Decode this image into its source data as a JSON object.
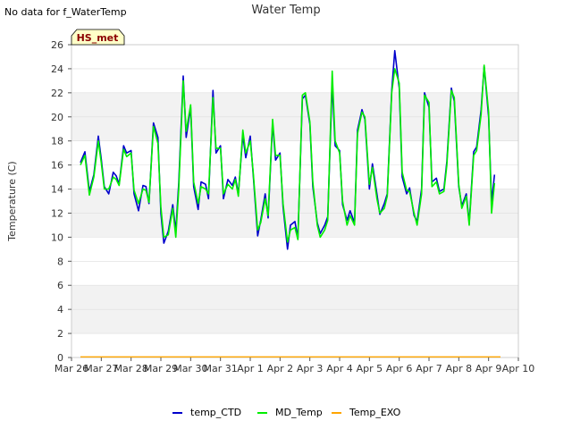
{
  "notice": "No data for f_WaterTemp",
  "badge": "HS_met",
  "chart_data": {
    "type": "line",
    "title": "Water Temp",
    "ylabel": "Temperature (C)",
    "xlabel": "",
    "ylim": [
      0,
      26
    ],
    "yticks": [
      0,
      2,
      4,
      6,
      8,
      10,
      12,
      14,
      16,
      18,
      20,
      22,
      24,
      26
    ],
    "xlim": [
      "Mar 26",
      "Apr 10"
    ],
    "xticks": [
      "Mar 26",
      "Mar 27",
      "Mar 28",
      "Mar 29",
      "Mar 30",
      "Mar 31",
      "Apr 1",
      "Apr 2",
      "Apr 3",
      "Apr 4",
      "Apr 5",
      "Apr 6",
      "Apr 7",
      "Apr 8",
      "Apr 9",
      "Apr 10"
    ],
    "grid": "horizontal bands",
    "legend_position": "bottom",
    "series": [
      {
        "name": "temp_CTD",
        "color": "#0000cc",
        "x": [
          0.3,
          0.45,
          0.6,
          0.75,
          0.9,
          1.0,
          1.1,
          1.25,
          1.4,
          1.5,
          1.6,
          1.75,
          1.85,
          2.0,
          2.1,
          2.25,
          2.4,
          2.5,
          2.6,
          2.75,
          2.9,
          3.0,
          3.1,
          3.25,
          3.4,
          3.5,
          3.6,
          3.75,
          3.85,
          4.0,
          4.1,
          4.25,
          4.35,
          4.5,
          4.6,
          4.75,
          4.85,
          5.0,
          5.1,
          5.25,
          5.4,
          5.5,
          5.6,
          5.75,
          5.85,
          6.0,
          6.1,
          6.25,
          6.35,
          6.5,
          6.6,
          6.75,
          6.85,
          7.0,
          7.1,
          7.25,
          7.35,
          7.5,
          7.6,
          7.75,
          7.85,
          8.0,
          8.1,
          8.25,
          8.35,
          8.5,
          8.6,
          8.75,
          8.85,
          9.0,
          9.1,
          9.25,
          9.35,
          9.5,
          9.6,
          9.75,
          9.85,
          10.0,
          10.1,
          10.25,
          10.35,
          10.5,
          10.6,
          10.75,
          10.85,
          11.0,
          11.1,
          11.25,
          11.35,
          11.5,
          11.6,
          11.75,
          11.85,
          12.0,
          12.1,
          12.25,
          12.35,
          12.5,
          12.6,
          12.75,
          12.85,
          13.0,
          13.1,
          13.25,
          13.35,
          13.5,
          13.6,
          13.75,
          13.85,
          14.0,
          14.1,
          14.2
        ],
        "y": [
          16.2,
          17.1,
          13.8,
          15.2,
          18.4,
          16.5,
          14.2,
          13.6,
          15.4,
          15.1,
          14.4,
          17.6,
          17.0,
          17.2,
          13.6,
          12.2,
          14.3,
          14.2,
          12.8,
          19.5,
          18.3,
          12.0,
          9.5,
          10.5,
          12.7,
          10.5,
          14.5,
          23.4,
          18.3,
          20.8,
          14.2,
          12.3,
          14.6,
          14.4,
          13.2,
          22.2,
          17.0,
          17.6,
          13.2,
          14.8,
          14.3,
          15.0,
          13.6,
          18.5,
          16.6,
          18.4,
          15.2,
          10.1,
          11.4,
          13.6,
          11.6,
          19.5,
          16.4,
          17.0,
          12.5,
          9.0,
          11.0,
          11.3,
          9.9,
          21.5,
          21.8,
          19.4,
          14.2,
          11.2,
          10.3,
          11.0,
          11.7,
          22.8,
          17.6,
          17.2,
          12.7,
          11.4,
          12.2,
          11.2,
          18.9,
          20.6,
          19.8,
          14.0,
          16.1,
          13.6,
          11.9,
          12.8,
          13.6,
          22.2,
          25.5,
          22.4,
          15.0,
          13.6,
          14.1,
          11.8,
          11.3,
          14.0,
          22.0,
          20.8,
          14.6,
          14.9,
          13.8,
          14.0,
          16.3,
          22.4,
          21.3,
          14.2,
          12.6,
          13.6,
          11.2,
          17.1,
          17.5,
          20.6,
          24.2,
          20.0,
          12.9,
          15.2
        ]
      },
      {
        "name": "MD_Temp",
        "color": "#00ee00",
        "x": [
          0.3,
          0.45,
          0.6,
          0.75,
          0.9,
          1.0,
          1.1,
          1.25,
          1.4,
          1.5,
          1.6,
          1.75,
          1.85,
          2.0,
          2.1,
          2.25,
          2.4,
          2.5,
          2.6,
          2.75,
          2.9,
          3.0,
          3.1,
          3.25,
          3.4,
          3.5,
          3.6,
          3.75,
          3.85,
          4.0,
          4.1,
          4.25,
          4.35,
          4.5,
          4.6,
          4.75,
          4.85,
          5.0,
          5.1,
          5.25,
          5.4,
          5.5,
          5.6,
          5.75,
          5.85,
          6.0,
          6.1,
          6.25,
          6.35,
          6.5,
          6.6,
          6.75,
          6.85,
          7.0,
          7.1,
          7.25,
          7.35,
          7.5,
          7.6,
          7.75,
          7.85,
          8.0,
          8.1,
          8.25,
          8.35,
          8.5,
          8.6,
          8.75,
          8.85,
          9.0,
          9.1,
          9.25,
          9.35,
          9.5,
          9.6,
          9.75,
          9.85,
          10.0,
          10.1,
          10.25,
          10.35,
          10.5,
          10.6,
          10.75,
          10.85,
          11.0,
          11.1,
          11.25,
          11.35,
          11.5,
          11.6,
          11.75,
          11.85,
          12.0,
          12.1,
          12.25,
          12.35,
          12.5,
          12.6,
          12.75,
          12.85,
          13.0,
          13.1,
          13.25,
          13.35,
          13.5,
          13.6,
          13.75,
          13.85,
          14.0,
          14.1,
          14.2
        ],
        "y": [
          16.0,
          16.8,
          13.5,
          15.0,
          18.0,
          16.2,
          14.0,
          14.0,
          15.0,
          14.8,
          14.3,
          17.3,
          16.7,
          17.0,
          13.9,
          12.8,
          14.0,
          13.9,
          12.9,
          19.2,
          17.8,
          12.5,
          10.0,
          10.2,
          12.4,
          10.0,
          14.0,
          23.0,
          18.8,
          21.0,
          14.6,
          12.8,
          14.2,
          14.0,
          13.6,
          21.6,
          17.4,
          17.4,
          13.6,
          14.4,
          14.0,
          14.8,
          13.4,
          18.9,
          17.0,
          18.0,
          15.4,
          10.6,
          11.2,
          13.2,
          11.8,
          19.8,
          16.8,
          16.8,
          12.8,
          9.6,
          10.6,
          10.8,
          9.8,
          21.8,
          22.0,
          19.6,
          14.6,
          11.0,
          10.0,
          10.6,
          11.4,
          23.8,
          18.0,
          17.0,
          13.0,
          11.0,
          11.8,
          11.0,
          18.6,
          20.4,
          20.0,
          14.4,
          15.8,
          13.2,
          12.0,
          12.4,
          13.4,
          22.0,
          24.0,
          22.8,
          15.4,
          13.9,
          13.8,
          12.0,
          11.0,
          13.6,
          21.8,
          21.2,
          14.2,
          14.6,
          13.6,
          13.8,
          16.0,
          22.2,
          21.6,
          14.4,
          12.4,
          13.4,
          11.0,
          16.8,
          17.2,
          20.2,
          24.3,
          20.4,
          12.0,
          14.5
        ]
      },
      {
        "name": "Temp_EXO",
        "color": "#ffa500",
        "x": [
          0.3,
          14.4
        ],
        "y": [
          0.05,
          0.05
        ]
      }
    ]
  }
}
